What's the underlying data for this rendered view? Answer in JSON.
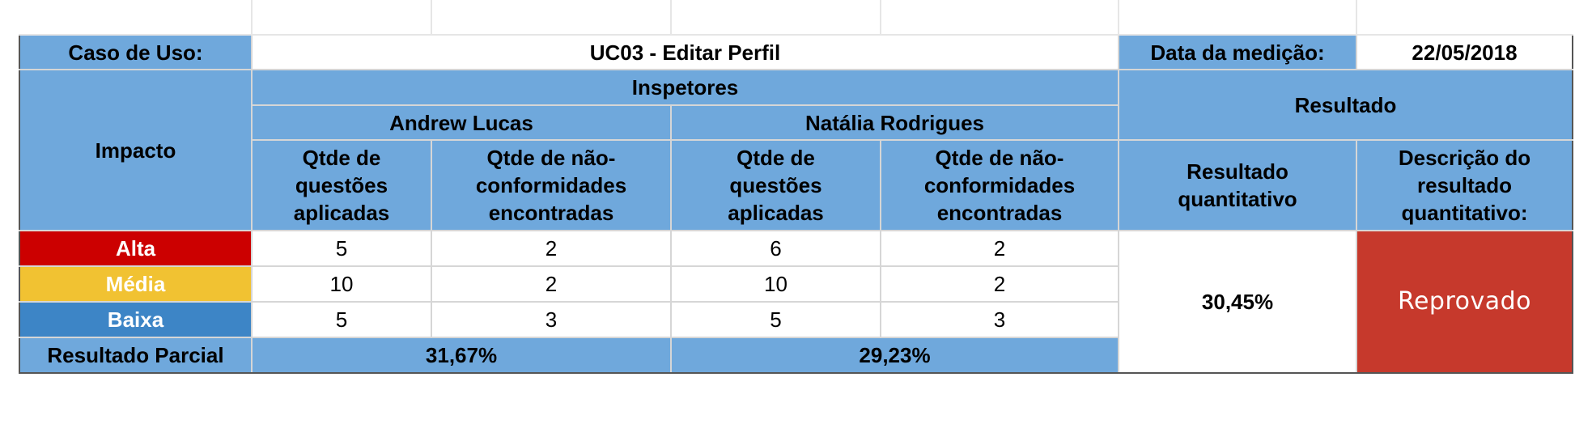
{
  "header": {
    "use_case_label": "Caso de Uso:",
    "use_case_value": "UC03 - Editar Perfil",
    "date_label": "Data da medição:",
    "date_value": "22/05/2018"
  },
  "columns": {
    "impacto": "Impacto",
    "inspetores": "Inspetores",
    "resultado": "Resultado",
    "inspector_1": "Andrew Lucas",
    "inspector_2": "Natália Rodrigues",
    "questions_applied": "Qtde de questões aplicadas",
    "nonconformities_found": "Qtde de não-conformidades encontradas",
    "result_quantitative": "Resultado quantitativo",
    "result_description": "Descrição do resultado quantitativo:"
  },
  "rows": [
    {
      "impact": "Alta",
      "color": "#cc0000",
      "i1_questions": "5",
      "i1_nc": "2",
      "i2_questions": "6",
      "i2_nc": "2"
    },
    {
      "impact": "Média",
      "color": "#f1c232",
      "i1_questions": "10",
      "i1_nc": "2",
      "i2_questions": "10",
      "i2_nc": "2"
    },
    {
      "impact": "Baixa",
      "color": "#3d85c6",
      "i1_questions": "5",
      "i1_nc": "3",
      "i2_questions": "5",
      "i2_nc": "3"
    }
  ],
  "partial": {
    "label": "Resultado Parcial",
    "inspector_1": "31,67%",
    "inspector_2": "29,23%"
  },
  "result": {
    "quantitative": "30,45%",
    "description": "Reprovado",
    "description_color": "#c6392c"
  },
  "colors": {
    "header_blue": "#6fa8dc"
  }
}
